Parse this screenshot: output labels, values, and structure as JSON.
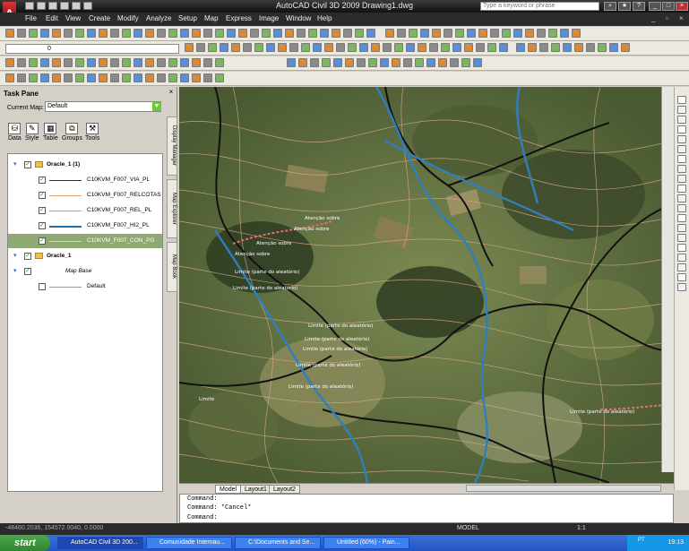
{
  "app": {
    "title": "AutoCAD Civil 3D 2009",
    "document": "Drawing1.dwg",
    "search_placeholder": "Type a keyword or phrase"
  },
  "menu": [
    "File",
    "Edit",
    "View",
    "Create",
    "Modify",
    "Analyze",
    "Setup",
    "Map",
    "Express",
    "Image",
    "Window",
    "Help"
  ],
  "layer_combo": "0",
  "task_pane": {
    "title": "Task Pane",
    "current_map_label": "Current Map:",
    "current_map_value": "Default",
    "tools": [
      {
        "label": "Data",
        "icon": "database-icon"
      },
      {
        "label": "Style",
        "icon": "brush-icon"
      },
      {
        "label": "Table",
        "icon": "table-icon"
      },
      {
        "label": "Groups",
        "icon": "groups-icon"
      },
      {
        "label": "Tools",
        "icon": "tools-icon"
      }
    ],
    "side_tabs": [
      "Display Manager",
      "Map Explorer",
      "Map Book"
    ],
    "tree": [
      {
        "label": "Oracle_1 (1)",
        "type": "group",
        "checked": true,
        "bold": true
      },
      {
        "label": "C10KVM_F007_VIA_PL",
        "type": "layer",
        "checked": true,
        "line_color": "#333333"
      },
      {
        "label": "C10KVM_F007_RELCOTAS",
        "type": "layer",
        "checked": true,
        "line_color": "#e0a070"
      },
      {
        "label": "C10KVM_F007_REL_PL",
        "type": "layer",
        "checked": true,
        "line_color": "#c8a070"
      },
      {
        "label": "C10KVM_F007_HI2_PL",
        "type": "layer",
        "checked": true,
        "line_color": "#1f6fa8"
      },
      {
        "label": "C10KVM_F007_CON_PG",
        "type": "layer",
        "checked": true,
        "line_color": "#cfe6a8",
        "selected": true
      },
      {
        "label": "Oracle_1",
        "type": "group",
        "checked": true,
        "bold": true
      },
      {
        "label": "Map Base",
        "type": "group",
        "checked": true,
        "italic": true
      },
      {
        "label": "Default",
        "type": "layer",
        "checked": false,
        "line_color": "#999999"
      }
    ]
  },
  "map_labels": [
    "Atenção sobre",
    "Atenção sobre",
    "Atenção sobre",
    "Atenção sobre",
    "Limite (parte do aleatório)",
    "Limite (parte do aleatório)",
    "Limite (parte do aleatório)",
    "Limite (parte do aleatório)",
    "Limite (parte do aleatório)",
    "Limite (parte do aleatório)",
    "Limite (parte do aleatório)",
    "Limite",
    "Limite (parte do aleatório)"
  ],
  "layout_tabs": [
    "Model",
    "Layout1",
    "Layout2"
  ],
  "command_lines": [
    "Command:",
    "Command: *Cancel*",
    "Command:"
  ],
  "status": {
    "coords": "-48460.2036, 154572.0040, 0.0000",
    "model_label": "MODEL",
    "scale": "1:1"
  },
  "taskbar": {
    "start": "start",
    "tasks": [
      "AutoCAD Civil 3D 200...",
      "Comunidade Internau...",
      "C:\\Documents and Se...",
      "Untitled (60%) - Pain..."
    ],
    "lang": "PT",
    "time": "19:13"
  }
}
